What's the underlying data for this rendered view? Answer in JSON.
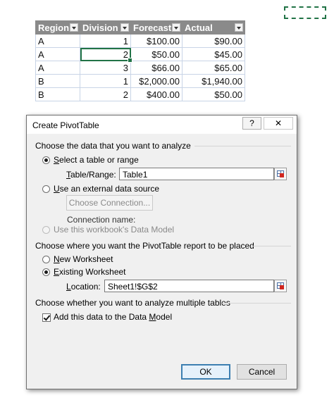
{
  "sheet": {
    "headers": [
      "Region",
      "Division",
      "Forecast",
      "Actual"
    ],
    "rows": [
      [
        "A",
        "1",
        "$100.00",
        "$90.00"
      ],
      [
        "A",
        "2",
        "$50.00",
        "$45.00"
      ],
      [
        "A",
        "3",
        "$66.00",
        "$65.00"
      ],
      [
        "B",
        "1",
        "$2,000.00",
        "$1,940.00"
      ],
      [
        "B",
        "2",
        "$400.00",
        "$50.00"
      ]
    ]
  },
  "dialog": {
    "title": "Create PivotTable",
    "help_label": "?",
    "close_label": "✕",
    "section1": "Choose the data that you want to analyze",
    "opt_table_pre": "S",
    "opt_table_rest": "elect a table or range",
    "table_range_pre": "T",
    "table_range_rest": "able/Range:",
    "table_range_value": "Table1",
    "opt_external_pre": "U",
    "opt_external_rest": "se an external data source",
    "choose_connection": "Choose Connection...",
    "connection_name_label": "Connection name:",
    "opt_data_model": "Use this workbook's Data Model",
    "section2": "Choose where you want the PivotTable report to be placed",
    "opt_new_pre": "N",
    "opt_new_rest": "ew Worksheet",
    "opt_existing_pre": "E",
    "opt_existing_rest": "xisting Worksheet",
    "location_pre": "L",
    "location_rest": "ocation:",
    "location_value": "Sheet1!$G$2",
    "section3": "Choose whether you want to analyze multiple tables",
    "add_data_model_pre": "Add this data to the Data ",
    "add_data_model_u": "M",
    "add_data_model_rest": "odel",
    "ok_label": "OK",
    "cancel_label": "Cancel"
  }
}
